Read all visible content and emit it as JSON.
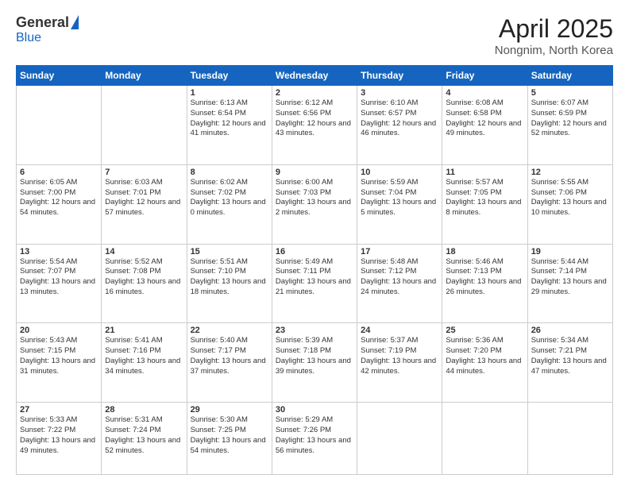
{
  "header": {
    "logo_general": "General",
    "logo_blue": "Blue",
    "month_year": "April 2025",
    "location": "Nongnim, North Korea"
  },
  "days_of_week": [
    "Sunday",
    "Monday",
    "Tuesday",
    "Wednesday",
    "Thursday",
    "Friday",
    "Saturday"
  ],
  "weeks": [
    [
      {
        "day": "",
        "info": ""
      },
      {
        "day": "",
        "info": ""
      },
      {
        "day": "1",
        "info": "Sunrise: 6:13 AM\nSunset: 6:54 PM\nDaylight: 12 hours\nand 41 minutes."
      },
      {
        "day": "2",
        "info": "Sunrise: 6:12 AM\nSunset: 6:56 PM\nDaylight: 12 hours\nand 43 minutes."
      },
      {
        "day": "3",
        "info": "Sunrise: 6:10 AM\nSunset: 6:57 PM\nDaylight: 12 hours\nand 46 minutes."
      },
      {
        "day": "4",
        "info": "Sunrise: 6:08 AM\nSunset: 6:58 PM\nDaylight: 12 hours\nand 49 minutes."
      },
      {
        "day": "5",
        "info": "Sunrise: 6:07 AM\nSunset: 6:59 PM\nDaylight: 12 hours\nand 52 minutes."
      }
    ],
    [
      {
        "day": "6",
        "info": "Sunrise: 6:05 AM\nSunset: 7:00 PM\nDaylight: 12 hours\nand 54 minutes."
      },
      {
        "day": "7",
        "info": "Sunrise: 6:03 AM\nSunset: 7:01 PM\nDaylight: 12 hours\nand 57 minutes."
      },
      {
        "day": "8",
        "info": "Sunrise: 6:02 AM\nSunset: 7:02 PM\nDaylight: 13 hours\nand 0 minutes."
      },
      {
        "day": "9",
        "info": "Sunrise: 6:00 AM\nSunset: 7:03 PM\nDaylight: 13 hours\nand 2 minutes."
      },
      {
        "day": "10",
        "info": "Sunrise: 5:59 AM\nSunset: 7:04 PM\nDaylight: 13 hours\nand 5 minutes."
      },
      {
        "day": "11",
        "info": "Sunrise: 5:57 AM\nSunset: 7:05 PM\nDaylight: 13 hours\nand 8 minutes."
      },
      {
        "day": "12",
        "info": "Sunrise: 5:55 AM\nSunset: 7:06 PM\nDaylight: 13 hours\nand 10 minutes."
      }
    ],
    [
      {
        "day": "13",
        "info": "Sunrise: 5:54 AM\nSunset: 7:07 PM\nDaylight: 13 hours\nand 13 minutes."
      },
      {
        "day": "14",
        "info": "Sunrise: 5:52 AM\nSunset: 7:08 PM\nDaylight: 13 hours\nand 16 minutes."
      },
      {
        "day": "15",
        "info": "Sunrise: 5:51 AM\nSunset: 7:10 PM\nDaylight: 13 hours\nand 18 minutes."
      },
      {
        "day": "16",
        "info": "Sunrise: 5:49 AM\nSunset: 7:11 PM\nDaylight: 13 hours\nand 21 minutes."
      },
      {
        "day": "17",
        "info": "Sunrise: 5:48 AM\nSunset: 7:12 PM\nDaylight: 13 hours\nand 24 minutes."
      },
      {
        "day": "18",
        "info": "Sunrise: 5:46 AM\nSunset: 7:13 PM\nDaylight: 13 hours\nand 26 minutes."
      },
      {
        "day": "19",
        "info": "Sunrise: 5:44 AM\nSunset: 7:14 PM\nDaylight: 13 hours\nand 29 minutes."
      }
    ],
    [
      {
        "day": "20",
        "info": "Sunrise: 5:43 AM\nSunset: 7:15 PM\nDaylight: 13 hours\nand 31 minutes."
      },
      {
        "day": "21",
        "info": "Sunrise: 5:41 AM\nSunset: 7:16 PM\nDaylight: 13 hours\nand 34 minutes."
      },
      {
        "day": "22",
        "info": "Sunrise: 5:40 AM\nSunset: 7:17 PM\nDaylight: 13 hours\nand 37 minutes."
      },
      {
        "day": "23",
        "info": "Sunrise: 5:39 AM\nSunset: 7:18 PM\nDaylight: 13 hours\nand 39 minutes."
      },
      {
        "day": "24",
        "info": "Sunrise: 5:37 AM\nSunset: 7:19 PM\nDaylight: 13 hours\nand 42 minutes."
      },
      {
        "day": "25",
        "info": "Sunrise: 5:36 AM\nSunset: 7:20 PM\nDaylight: 13 hours\nand 44 minutes."
      },
      {
        "day": "26",
        "info": "Sunrise: 5:34 AM\nSunset: 7:21 PM\nDaylight: 13 hours\nand 47 minutes."
      }
    ],
    [
      {
        "day": "27",
        "info": "Sunrise: 5:33 AM\nSunset: 7:22 PM\nDaylight: 13 hours\nand 49 minutes."
      },
      {
        "day": "28",
        "info": "Sunrise: 5:31 AM\nSunset: 7:24 PM\nDaylight: 13 hours\nand 52 minutes."
      },
      {
        "day": "29",
        "info": "Sunrise: 5:30 AM\nSunset: 7:25 PM\nDaylight: 13 hours\nand 54 minutes."
      },
      {
        "day": "30",
        "info": "Sunrise: 5:29 AM\nSunset: 7:26 PM\nDaylight: 13 hours\nand 56 minutes."
      },
      {
        "day": "",
        "info": ""
      },
      {
        "day": "",
        "info": ""
      },
      {
        "day": "",
        "info": ""
      }
    ]
  ]
}
